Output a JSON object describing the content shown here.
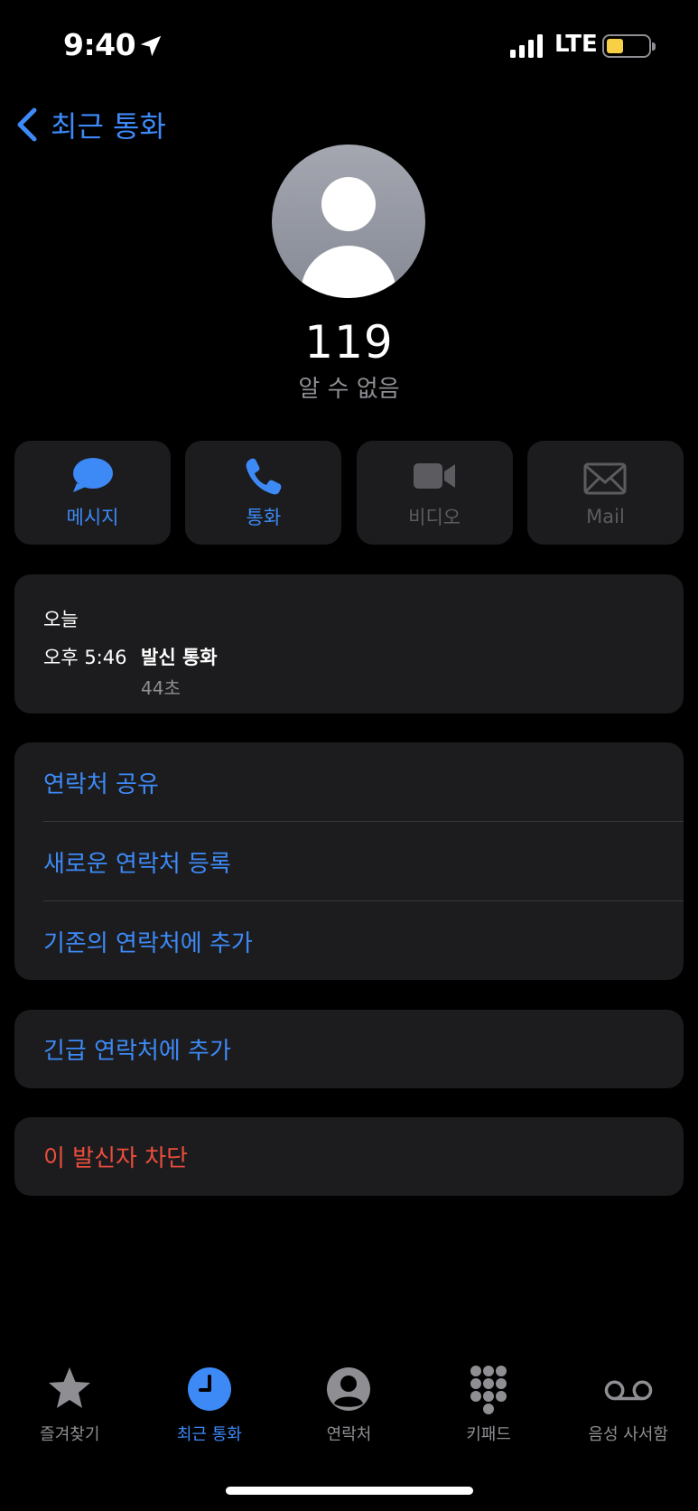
{
  "status_bar": {
    "time": "9:40",
    "network": "LTE",
    "battery_level": 0.4,
    "battery_color": "#f7d046"
  },
  "nav": {
    "back_label": "최근 통화",
    "back_icon": "chevron-left-icon"
  },
  "caller": {
    "name": "119",
    "subtitle": "알 수 없음"
  },
  "actions": [
    {
      "label": "메시지",
      "icon": "message-bubble-icon",
      "enabled": true
    },
    {
      "label": "통화",
      "icon": "phone-icon",
      "enabled": true
    },
    {
      "label": "비디오",
      "icon": "video-camera-icon",
      "enabled": false
    },
    {
      "label": "Mail",
      "icon": "envelope-icon",
      "enabled": false
    }
  ],
  "history": {
    "day": "오늘",
    "time": "오후 5:46",
    "type": "발신 통화",
    "duration": "44초"
  },
  "options": {
    "share_contact": "연락처 공유",
    "new_contact": "새로운 연락처 등록",
    "add_existing": "기존의 연락처에 추가",
    "add_emergency": "긴급 연락처에 추가",
    "block_caller": "이 발신자 차단"
  },
  "tabs": [
    {
      "label": "즐겨찾기",
      "icon": "star-icon",
      "active": false
    },
    {
      "label": "최근 통화",
      "icon": "clock-icon",
      "active": true
    },
    {
      "label": "연락처",
      "icon": "person-circle-icon",
      "active": false
    },
    {
      "label": "키패드",
      "icon": "keypad-icon",
      "active": false
    },
    {
      "label": "음성 사서함",
      "icon": "voicemail-icon",
      "active": false
    }
  ],
  "colors": {
    "accent": "#3d8af7",
    "destructive": "#eb4d3d",
    "card_bg": "#1c1c1e",
    "inactive": "#8e8e93"
  }
}
